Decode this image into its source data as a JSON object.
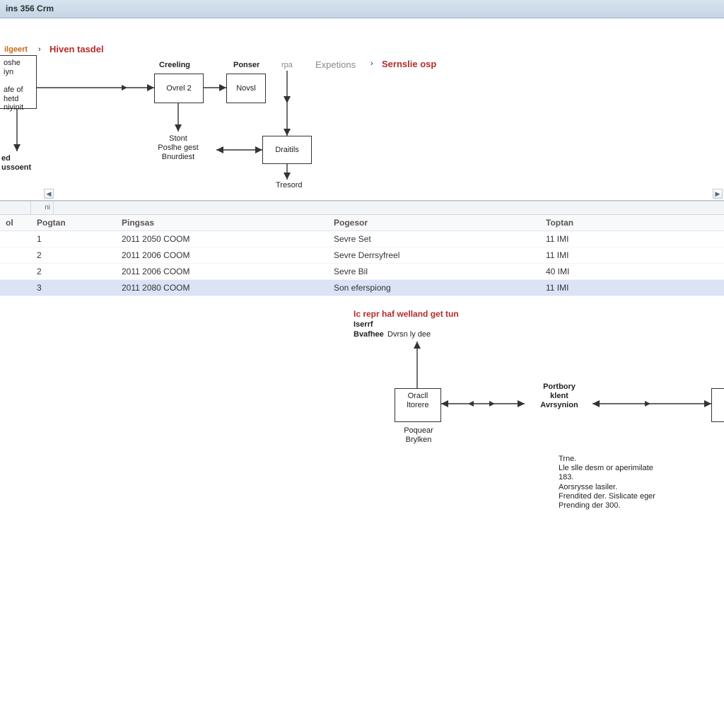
{
  "titlebar": {
    "text": "ins 356 Crm"
  },
  "top": {
    "breadcrumb_link": "ilgeert",
    "breadcrumb_sep": "›",
    "breadcrumb_current": "Hiven tasdel",
    "expetions_lbl": "Expetions",
    "expetions_sep": "›",
    "expetions_target": "Sernslie osp",
    "node_left": "oshe\niyn\n\nafe of hetd\nniyinit",
    "left_below": "ed\nussoent",
    "creeling_hdr": "Creeling",
    "node_oval2": "Ovrel 2",
    "oval2_below": "Stont\nPoslhe gest\nBnurdiest",
    "popser_hdr": "Ponser",
    "node_novsl": "Novsl",
    "cpa_lbl": "rpa",
    "node_disable": "Draitils",
    "disable_below": "Tresord"
  },
  "grid": {
    "ni": "ni",
    "headers": {
      "c0": "ol",
      "c1": "Pogtan",
      "c2": "Pingsas",
      "c3": "Pogesor",
      "c4": "Toptan"
    },
    "rows": [
      {
        "c1": "1",
        "c2": "2011 2050 COOM",
        "c3": "Sevre Set",
        "c4": "11 IMI"
      },
      {
        "c1": "2",
        "c2": "2011 2006 COOM",
        "c3": "Sevre Derrsyfreel",
        "c4": "11 IMI"
      },
      {
        "c1": "2",
        "c2": "2011 2006 COOM",
        "c3": "Sevre Bil",
        "c4": "40 IMI"
      },
      {
        "c1": "3",
        "c2": "2011 2080 COOM",
        "c3": "Son eferspiong",
        "c4": "11 IMI",
        "sel": true
      }
    ]
  },
  "low": {
    "warn": "Ic repr haf welland get tun",
    "warn_sub": "Iserrf",
    "warn_sub2b": "Bvafhee",
    "warn_sub2": "Dvrsn ly dee",
    "node_ovacl": "Oracll\nltorere",
    "ovacl_below": "Poquear\nBrylken",
    "mid_label": "Portbory\nklent\nAvrsynion",
    "info_block": "Trne.\nLle slle desm or aperimilate\n183.\nAorsrysse lasiler.\nFrendited der. Sislicate eger\nPrending der 300."
  }
}
